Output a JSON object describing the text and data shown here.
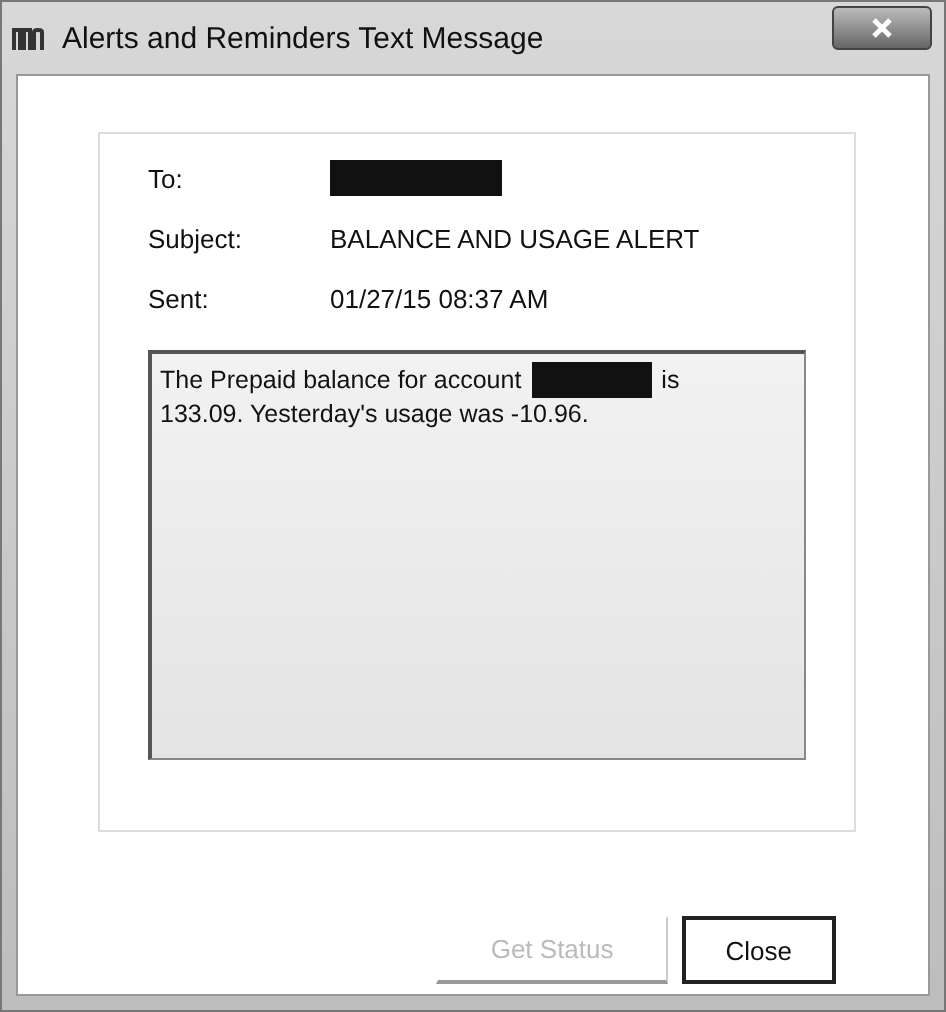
{
  "window": {
    "title": "Alerts and Reminders Text Message"
  },
  "fields": [
    {
      "label": "To:",
      "kind": "redacted"
    },
    {
      "label": "Subject:",
      "kind": "text",
      "value": "BALANCE AND USAGE ALERT"
    },
    {
      "label": "Sent:",
      "kind": "text",
      "value": "01/27/15 08:37 AM"
    }
  ],
  "message": {
    "lines": [
      [
        {
          "kind": "text",
          "text": "The Prepaid balance for account"
        },
        {
          "kind": "redacted"
        },
        {
          "kind": "text",
          "text": "is"
        }
      ],
      [
        {
          "kind": "text",
          "text": "133.09. Yesterday's usage was -10.96."
        }
      ]
    ]
  },
  "buttons": [
    {
      "label": "Get Status",
      "disabled": true
    },
    {
      "label": "Close",
      "disabled": false
    }
  ]
}
